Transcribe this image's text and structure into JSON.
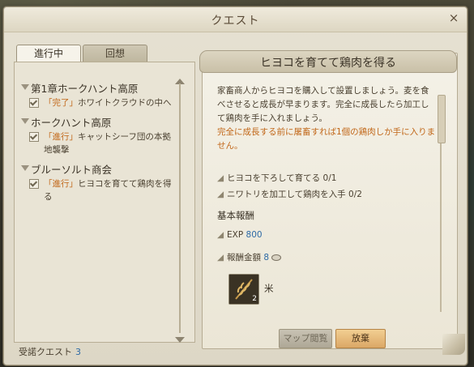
{
  "window": {
    "title": "クエスト",
    "close": "×"
  },
  "tabs": {
    "in_progress": "進行中",
    "recall": "回想"
  },
  "quest_groups": [
    {
      "name": "第1章ホークハント高原",
      "items": [
        {
          "tag": "「完了」",
          "text": "ホワイトクラウドの中へ"
        }
      ]
    },
    {
      "name": "ホークハント高原",
      "items": [
        {
          "tag": "「進行」",
          "text": "キャットシーフ団の本拠地襲撃"
        }
      ]
    },
    {
      "name": "ブルーソルト商会",
      "items": [
        {
          "tag": "「進行」",
          "text": "ヒヨコを育てて鶏肉を得る"
        }
      ]
    }
  ],
  "accepted": {
    "label": "受諾クエスト",
    "count": "3"
  },
  "detail": {
    "title": "ヒヨコを育てて鶏肉を得る",
    "description": "家畜商人からヒヨコを購入して設置しましょう。麦を食べさせると成長が早まります。完全に成長したら加工して鶏肉を手に入れましょう。",
    "warning": "完全に成長する前に屠畜すれば1個の鶏肉しか手に入りません。",
    "objectives": [
      "ヒヨコを下ろして育てる 0/1",
      "ニワトリを加工して鶏肉を入手 0/2"
    ],
    "reward_header": "基本報酬",
    "exp_label": "EXP",
    "exp_value": "800",
    "gold_label": "報酬金額",
    "gold_value": "8",
    "item": {
      "name": "米",
      "qty": "2"
    },
    "btn_map": "マップ閲覧",
    "btn_abandon": "放棄"
  }
}
